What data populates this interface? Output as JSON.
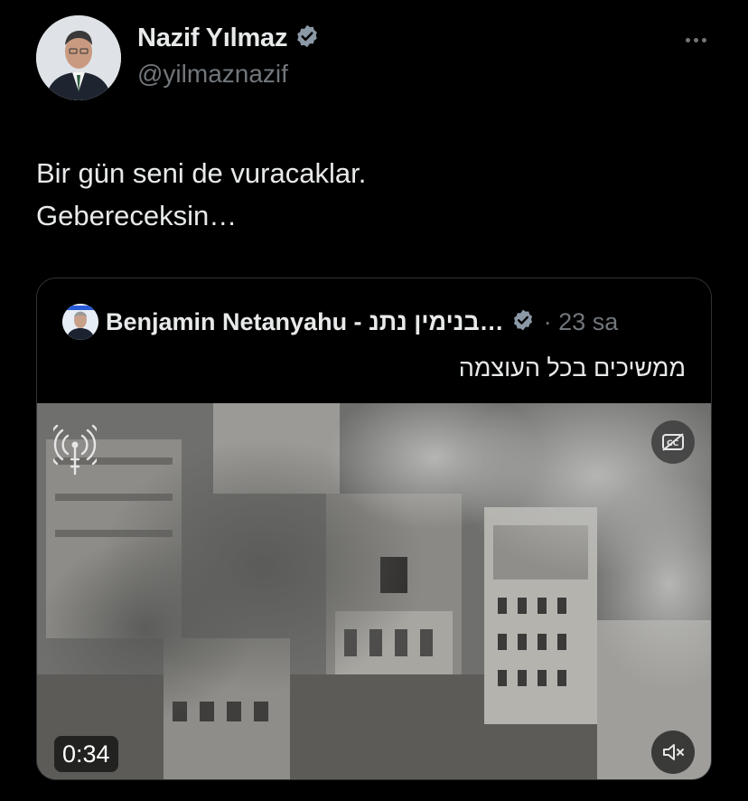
{
  "author": {
    "name": "Nazif Yılmaz",
    "handle": "@yilmaznazif",
    "verified": true,
    "avatar_icon": "profile-photo"
  },
  "tweet": {
    "lines": [
      "Bir gün seni de vuracaklar.",
      "Gebereceksin…"
    ]
  },
  "quoted": {
    "name": "Benjamin Netanyahu - בנימין נתנ…",
    "verified": true,
    "time": "· 23 sa",
    "text": "ממשיכים בכל העוצמה",
    "video": {
      "duration": "0:34",
      "live_icon": "broadcast-icon",
      "cc_icon": "captions-off-icon",
      "mute_icon": "speaker-muted-icon"
    }
  },
  "colors": {
    "background": "#000000",
    "text": "#e7e9ea",
    "secondary": "#71767b",
    "verified_badge": "#8b98a5",
    "border": "#2f3336"
  }
}
